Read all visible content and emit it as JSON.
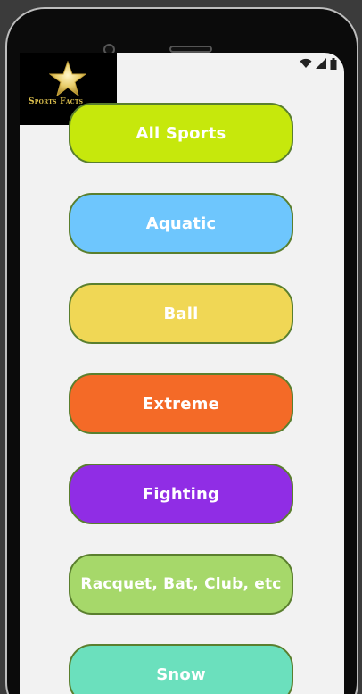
{
  "app": {
    "logo_text": "Sports Facts"
  },
  "status_bar": {
    "icons": [
      "wifi-icon",
      "cellular-signal-icon",
      "battery-icon"
    ]
  },
  "categories": [
    {
      "label": "All Sports",
      "color": "#c6e80c"
    },
    {
      "label": "Aquatic",
      "color": "#6ec6fd"
    },
    {
      "label": "Ball",
      "color": "#f0d755"
    },
    {
      "label": "Extreme",
      "color": "#f46a27"
    },
    {
      "label": "Fighting",
      "color": "#902de5"
    },
    {
      "label": "Racquet, Bat, Club, etc",
      "color": "#a6d86a"
    },
    {
      "label": "Snow",
      "color": "#6be0bd"
    }
  ],
  "colors": {
    "button_border": "#5a7f2e",
    "screen_background": "#f2f2f2",
    "logo_background": "#000000",
    "logo_gold": "#e0c34f"
  }
}
